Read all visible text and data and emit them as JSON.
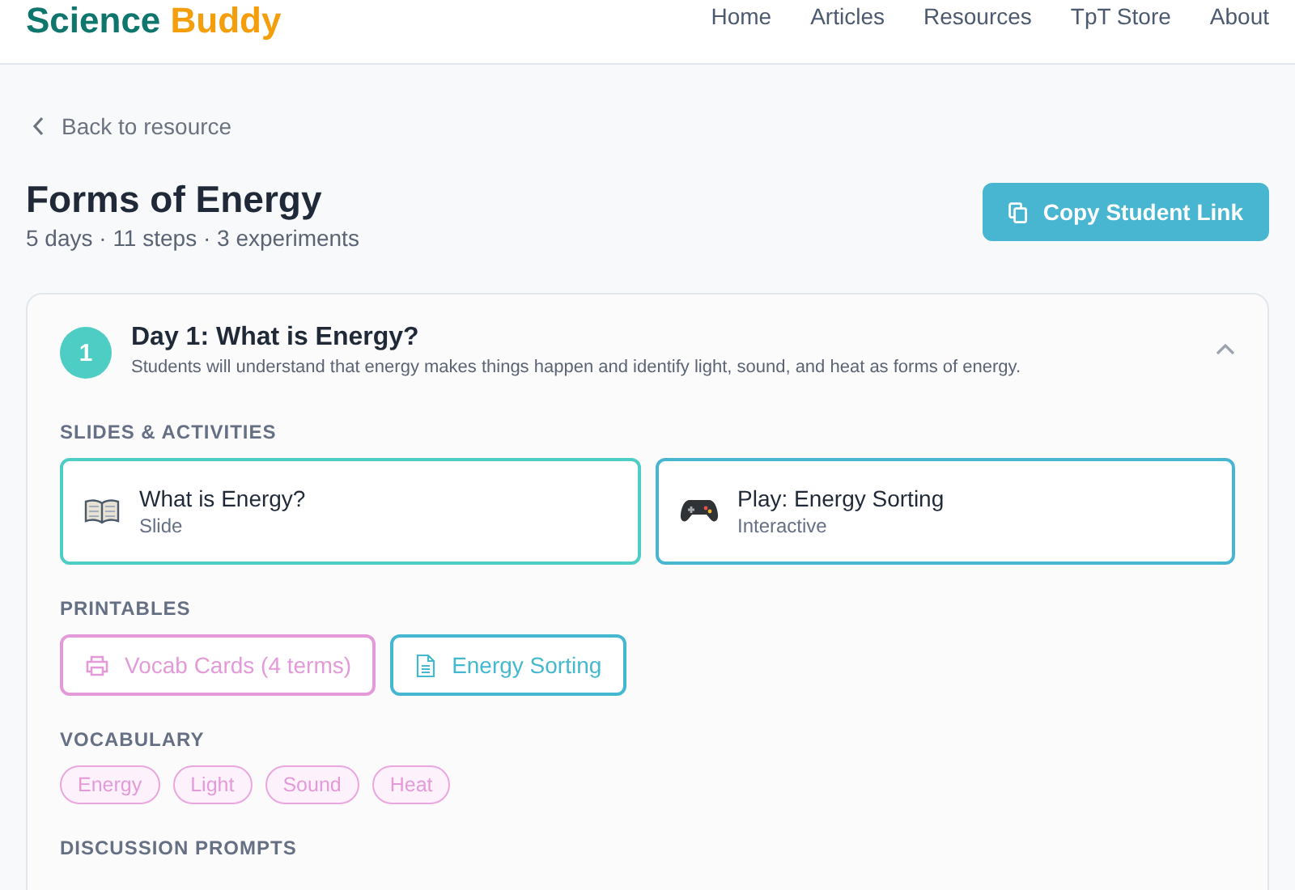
{
  "logo": {
    "part_1": "Science",
    "part_2": "Buddy"
  },
  "nav": [
    "Home",
    "Articles",
    "Resources",
    "TpT Store",
    "About"
  ],
  "back_link": "Back to resource",
  "title": "Forms of Energy",
  "subtitle": "5 days · 11 steps · 3 experiments",
  "copy_button": "Copy Student Link",
  "day": {
    "number": "1",
    "title": "Day 1: What is Energy?",
    "description": "Students will understand that energy makes things happen and identify light, sound, and heat as forms of energy.",
    "expanded": true,
    "sections": [
      {
        "heading": "SLIDES & ACTIVITIES",
        "kind": "activities",
        "items": [
          {
            "kind": "slide",
            "title": "What is Energy?",
            "type": "Slide"
          },
          {
            "kind": "interactive",
            "title": "Play: Energy Sorting",
            "type": "Interactive"
          }
        ]
      },
      {
        "heading": "PRINTABLES",
        "kind": "printables",
        "items": [
          {
            "kind": "print",
            "label": "Vocab Cards (4 terms)"
          },
          {
            "kind": "doc",
            "label": "Energy Sorting"
          }
        ]
      },
      {
        "heading": "VOCABULARY",
        "kind": "vocab",
        "items": [
          "Energy",
          "Light",
          "Sound",
          "Heat"
        ]
      },
      {
        "heading": "DISCUSSION PROMPTS",
        "kind": "prompts"
      }
    ]
  }
}
